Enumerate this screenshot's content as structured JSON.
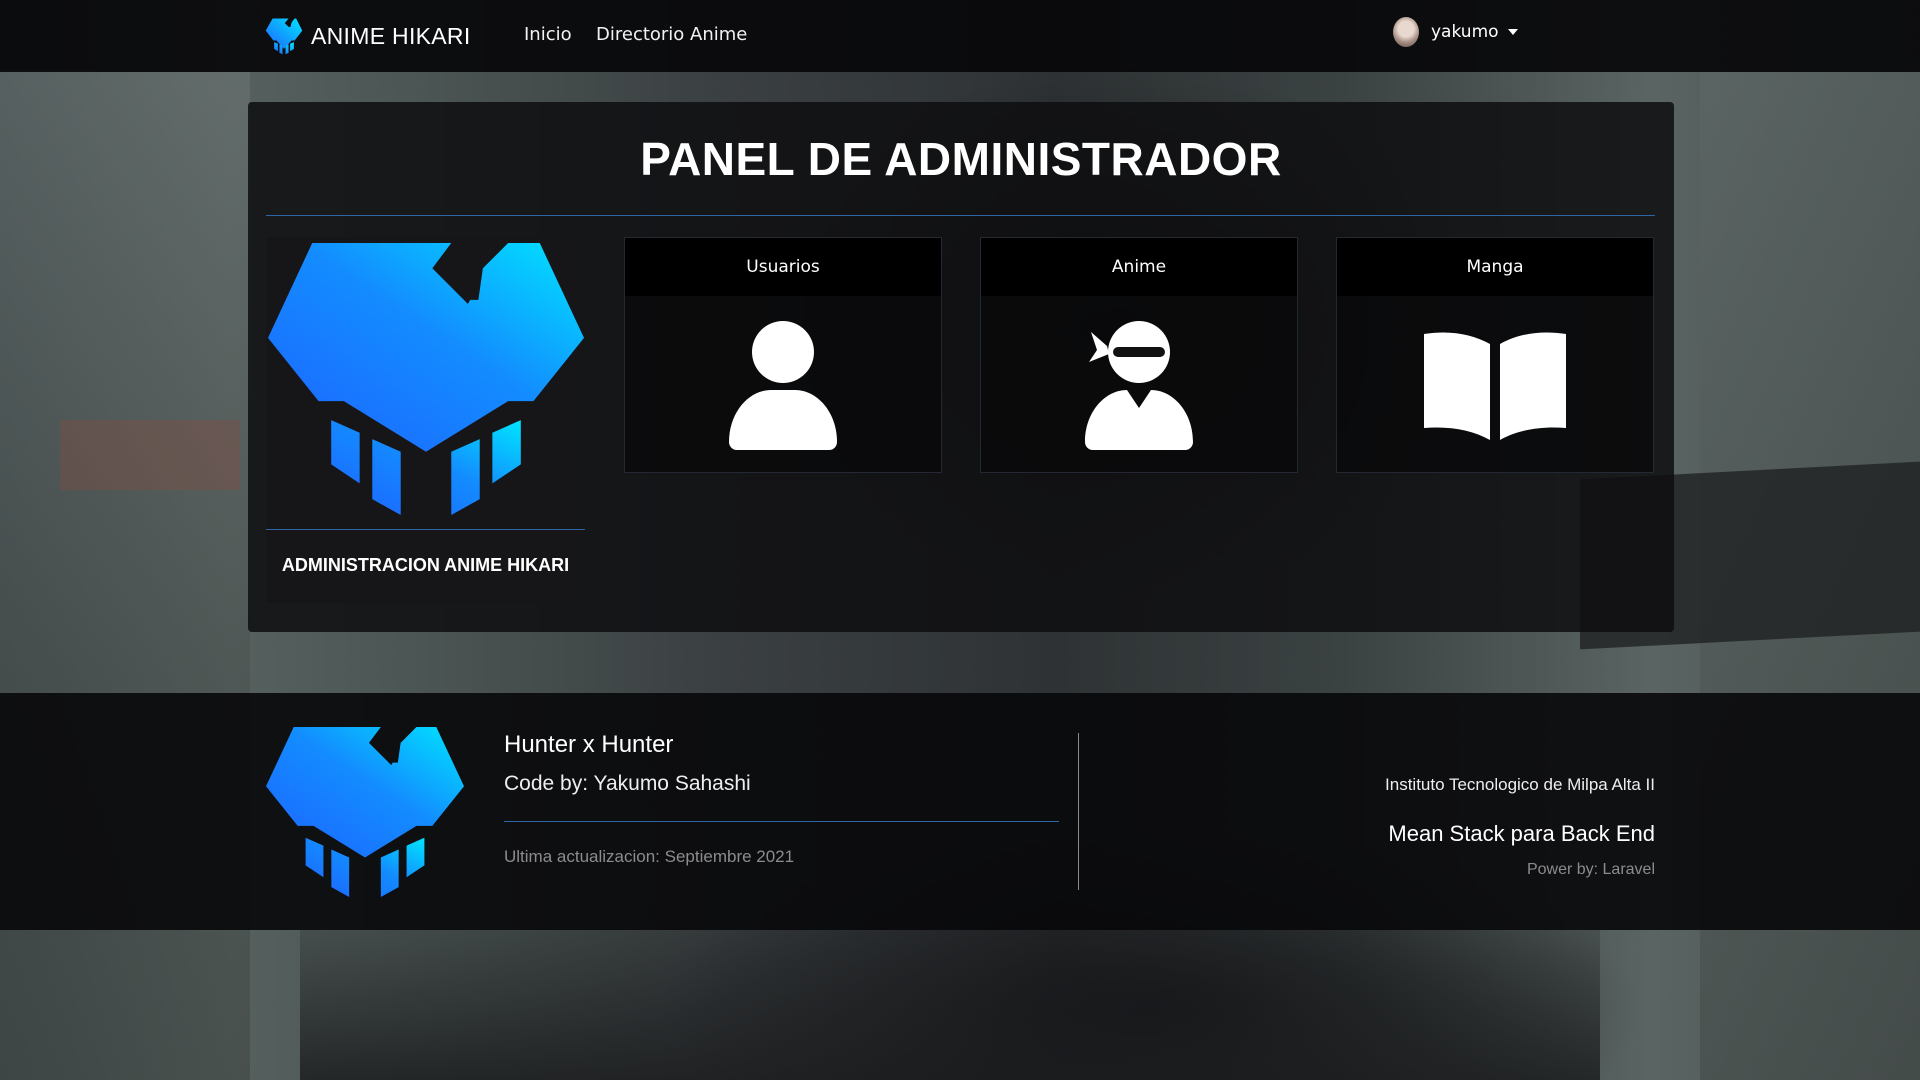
{
  "navbar": {
    "brand": "ANIME HIKARI",
    "links": [
      "Inicio",
      "Directorio Anime"
    ],
    "user": "yakumo"
  },
  "panel": {
    "title": "PANEL DE ADMINISTRADOR",
    "logo_caption": "ADMINISTRACION ANIME HIKARI",
    "tiles": [
      {
        "label": "Usuarios",
        "icon": "user-icon"
      },
      {
        "label": "Anime",
        "icon": "ninja-user-icon"
      },
      {
        "label": "Manga",
        "icon": "open-book-icon"
      }
    ]
  },
  "footer": {
    "title": "Hunter x Hunter",
    "subtitle": "Code by: Yakumo Sahashi",
    "update": "Ultima actualizacion: Septiembre 2021",
    "institute": "Instituto Tecnologico de Milpa Alta II",
    "stack": "Mean Stack para Back End",
    "power": "Power by: Laravel"
  },
  "colors": {
    "logo_gradient_start": "#1e63ff",
    "logo_gradient_end": "#00e5ff",
    "accent_rule": "#2f64a8"
  }
}
